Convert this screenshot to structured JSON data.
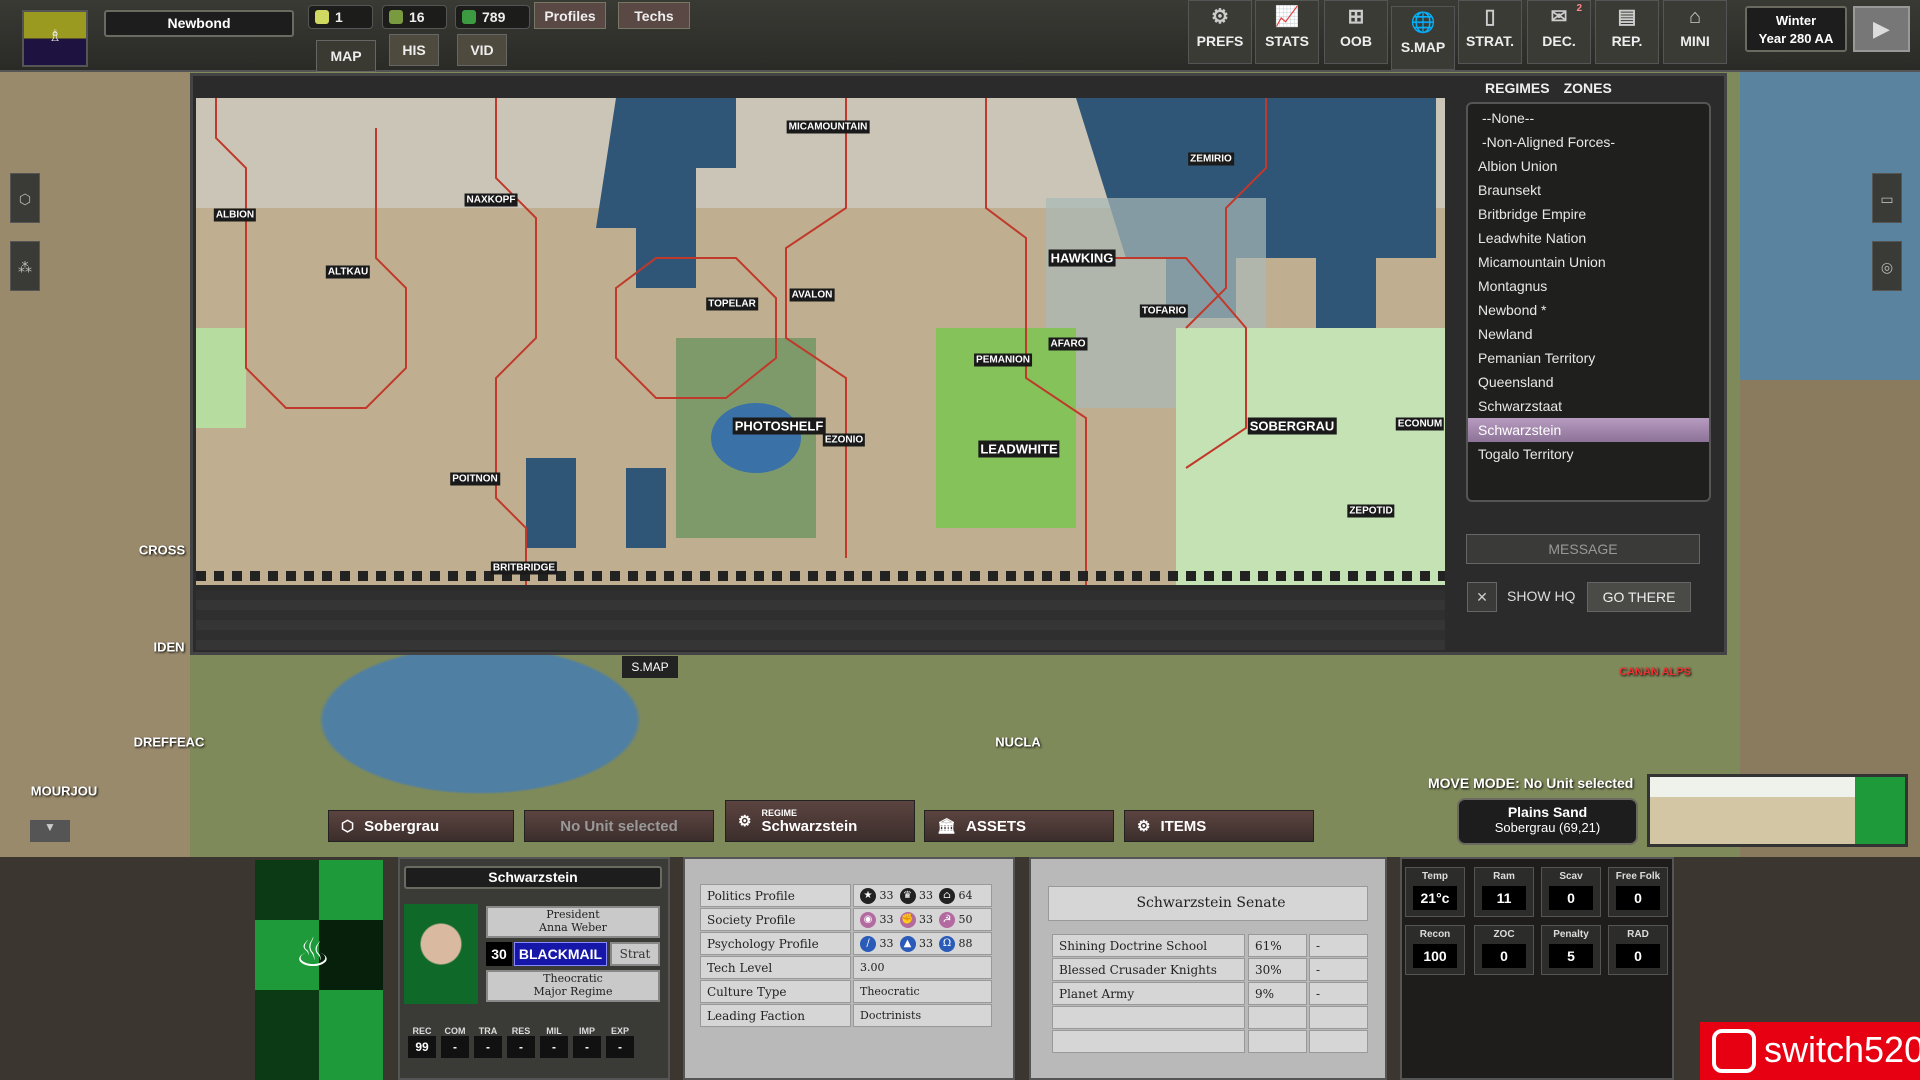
{
  "top": {
    "regime_name": "Newbond",
    "resources": [
      {
        "icon": "sun-icon",
        "value": "1"
      },
      {
        "icon": "soldier-icon",
        "value": "16"
      },
      {
        "icon": "money-icon",
        "value": "789"
      }
    ],
    "profiles": "Profiles",
    "techs": "Techs",
    "tabs": [
      "MAP",
      "HIS",
      "VID"
    ],
    "buttons": [
      {
        "label": "PREFS",
        "icon": "gear-icon",
        "glyph": "⚙"
      },
      {
        "label": "STATS",
        "icon": "chart-icon",
        "glyph": "📈"
      },
      {
        "label": "OOB",
        "icon": "hierarchy-icon",
        "glyph": "⊞"
      },
      {
        "label": "S.MAP",
        "icon": "globe-icon",
        "glyph": "🌐"
      },
      {
        "label": "STRAT.",
        "icon": "cards-icon",
        "glyph": "▯"
      },
      {
        "label": "DEC.",
        "icon": "envelope-icon",
        "glyph": "✉",
        "badge": "2"
      },
      {
        "label": "REP.",
        "icon": "report-icon",
        "glyph": "▤"
      },
      {
        "label": "MINI",
        "icon": "map-pin-icon",
        "glyph": "⌂"
      }
    ],
    "season": "Winter",
    "year": "Year 280 AA",
    "next_turn_icon": "play-arrow-icon"
  },
  "strategic_map": {
    "cities": [
      {
        "name": "ALBION"
      },
      {
        "name": "NAXKOPF"
      },
      {
        "name": "ALTKAU"
      },
      {
        "name": "MICAMOUNTAIN"
      },
      {
        "name": "TOPELAR"
      },
      {
        "name": "AVALON"
      },
      {
        "name": "HAWKING",
        "big": true
      },
      {
        "name": "ZEMIRIO"
      },
      {
        "name": "TOFARIO"
      },
      {
        "name": "PEMANION"
      },
      {
        "name": "AFARO"
      },
      {
        "name": "PHOTOSHELF",
        "big": true
      },
      {
        "name": "EZONIO"
      },
      {
        "name": "LEADWHITE",
        "big": true
      },
      {
        "name": "SOBERGRAU",
        "big": true
      },
      {
        "name": "ECONUM"
      },
      {
        "name": "ZEPOTID"
      },
      {
        "name": "POITNON"
      },
      {
        "name": "BRITBRIDGE"
      }
    ],
    "tab_label": "S.MAP"
  },
  "world_map": {
    "labels": [
      "CROSS",
      "IDEN",
      "DREFFEAC",
      "MOURJOU",
      "NUCLA"
    ],
    "region_label": "CANAN ALPS"
  },
  "regimes_panel": {
    "tabs": [
      "REGIMES",
      "ZONES"
    ],
    "items": [
      "--None--",
      "-Non-Aligned Forces-",
      "Albion Union",
      "Braunsekt",
      "Britbridge Empire",
      "Leadwhite Nation",
      "Micamountain Union",
      "Montagnus",
      "Newbond *",
      "Newland",
      "Pemanian Territory",
      "Queensland",
      "Schwarzstaat",
      "Schwarzstein",
      "Togalo Territory"
    ],
    "selected": "Schwarzstein",
    "message": "MESSAGE",
    "show_hq": "SHOW HQ",
    "go_there": "GO THERE"
  },
  "bottom_tabs": {
    "hex": "Sobergrau",
    "unit": "No Unit selected",
    "regime_small": "REGIME",
    "regime": "Schwarzstein",
    "assets": "ASSETS",
    "items": "ITEMS"
  },
  "move_mode": "MOVE MODE: No Unit selected",
  "hex_info": {
    "terrain": "Plains Sand",
    "location": "Sobergrau (69,21)"
  },
  "leader": {
    "regime": "Schwarzstein",
    "title": "President",
    "name": "Anna Weber",
    "points": "30",
    "action": "BLACKMAIL",
    "strat": "Strat",
    "type1": "Theocratic",
    "type2": "Major Regime",
    "stats": [
      {
        "l": "REC",
        "v": "99"
      },
      {
        "l": "COM",
        "v": "-"
      },
      {
        "l": "TRA",
        "v": "-"
      },
      {
        "l": "RES",
        "v": "-"
      },
      {
        "l": "MIL",
        "v": "-"
      },
      {
        "l": "IMP",
        "v": "-"
      },
      {
        "l": "EXP",
        "v": "-"
      }
    ]
  },
  "profile": {
    "rows": [
      {
        "label": "Politics Profile",
        "icons": [
          {
            "n": "star-icon",
            "g": "★",
            "c": "#222",
            "v": "33"
          },
          {
            "n": "crown-icon",
            "g": "♛",
            "c": "#222",
            "v": "33"
          },
          {
            "n": "temple-icon",
            "g": "⌂",
            "c": "#222",
            "v": "64"
          }
        ]
      },
      {
        "label": "Society Profile",
        "icons": [
          {
            "n": "eye-icon",
            "g": "◉",
            "c": "#b36aa0",
            "v": "33"
          },
          {
            "n": "fist-icon",
            "g": "✊",
            "c": "#b36aa0",
            "v": "33"
          },
          {
            "n": "hammer-sickle-icon",
            "g": "☭",
            "c": "#b36aa0",
            "v": "50"
          }
        ]
      },
      {
        "label": "Psychology Profile",
        "icons": [
          {
            "n": "sword-icon",
            "g": "/",
            "c": "#2a5bb8",
            "v": "33"
          },
          {
            "n": "graduation-cap-icon",
            "g": "▲",
            "c": "#2a5bb8",
            "v": "33"
          },
          {
            "n": "helmet-icon",
            "g": "Ω",
            "c": "#2a5bb8",
            "v": "88"
          }
        ]
      },
      {
        "label": "Tech Level",
        "value": "3.00"
      },
      {
        "label": "Culture Type",
        "value": "Theocratic"
      },
      {
        "label": "Leading Faction",
        "value": "Doctrinists"
      }
    ]
  },
  "senate": {
    "title": "Schwarzstein Senate",
    "rows": [
      [
        "Shining Doctrine School",
        "61%",
        "-"
      ],
      [
        "Blessed Crusader Knights",
        "30%",
        "-"
      ],
      [
        "Planet Army",
        "9%",
        "-"
      ],
      [
        "",
        "",
        ""
      ],
      [
        "",
        "",
        ""
      ]
    ]
  },
  "hex_stats": [
    {
      "l": "Temp",
      "v": "21°c"
    },
    {
      "l": "Ram",
      "v": "11"
    },
    {
      "l": "Scav",
      "v": "0"
    },
    {
      "l": "Free Folk",
      "v": "0"
    },
    {
      "l": "Recon",
      "v": "100"
    },
    {
      "l": "ZOC",
      "v": "0"
    },
    {
      "l": "Penalty",
      "v": "5"
    },
    {
      "l": "RAD",
      "v": "0"
    }
  ],
  "watermark": "switch520",
  "colors": {
    "selected_regime": "#a88bb2",
    "regime_flag": "#1e9a3a",
    "border_red": "#c0392b",
    "blackmail_bg": "#1616a8",
    "watermark_bg": "#e60012"
  }
}
